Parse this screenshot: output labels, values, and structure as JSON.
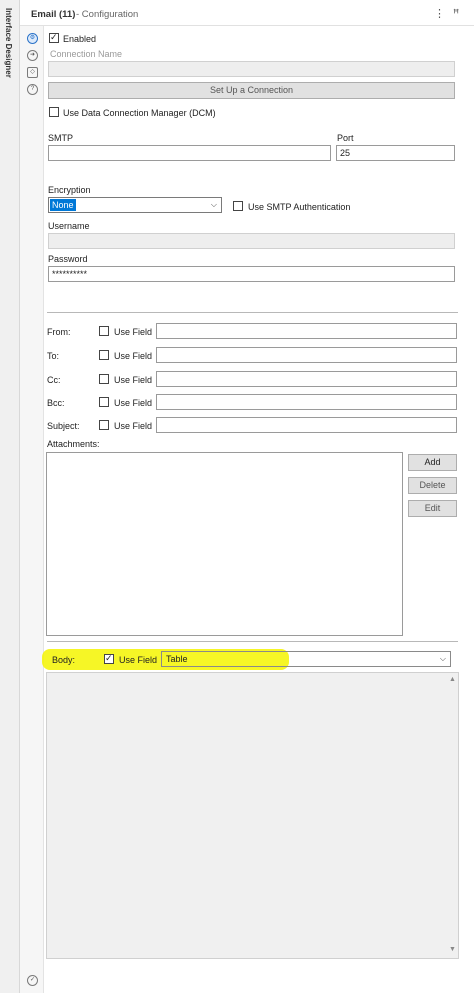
{
  "rail": {
    "label": "Interface Designer"
  },
  "header": {
    "title": "Email (11)",
    "subtitle": "- Configuration",
    "menu_icon": "⋮",
    "pin_icon": "ꟸ"
  },
  "side_icons": [
    "gear-icon",
    "arrow-circle-icon",
    "tag-icon",
    "help-icon",
    "check-circle-icon"
  ],
  "enabled": {
    "label": "Enabled",
    "checked": true
  },
  "connection_name": {
    "label": "Connection Name",
    "value": ""
  },
  "setup_button": {
    "label": "Set Up a Connection"
  },
  "dcm": {
    "label": "Use Data Connection Manager (DCM)",
    "checked": false
  },
  "smtp": {
    "label": "SMTP",
    "value": ""
  },
  "port": {
    "label": "Port",
    "value": "25"
  },
  "encryption": {
    "label": "Encryption",
    "value": "None"
  },
  "smtp_auth": {
    "label": "Use SMTP Authentication",
    "checked": false
  },
  "username": {
    "label": "Username",
    "value": ""
  },
  "password": {
    "label": "Password",
    "value": "**********"
  },
  "fields": [
    {
      "label": "From:",
      "use_field_label": "Use Field",
      "value": ""
    },
    {
      "label": "To:",
      "use_field_label": "Use Field",
      "value": ""
    },
    {
      "label": "Cc:",
      "use_field_label": "Use Field",
      "value": ""
    },
    {
      "label": "Bcc:",
      "use_field_label": "Use Field",
      "value": ""
    },
    {
      "label": "Subject:",
      "use_field_label": "Use Field",
      "value": ""
    }
  ],
  "attachments": {
    "label": "Attachments:",
    "add": "Add",
    "delete": "Delete",
    "edit": "Edit"
  },
  "body": {
    "label": "Body:",
    "use_field_label": "Use Field",
    "use_field_checked": true,
    "value": "Table"
  },
  "colors": {
    "accent": "#0078d7",
    "highlight": "#f5f500"
  }
}
